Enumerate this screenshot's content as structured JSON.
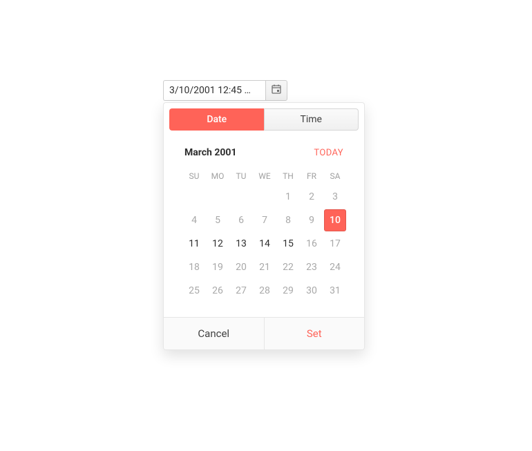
{
  "input": {
    "value": "3/10/2001 12:45 …"
  },
  "tabs": {
    "date": "Date",
    "time": "Time"
  },
  "calendar": {
    "month_label": "March 2001",
    "today_label": "TODAY",
    "weekdays": [
      "SU",
      "MO",
      "TU",
      "WE",
      "TH",
      "FR",
      "SA"
    ],
    "cells": [
      {
        "t": "",
        "cls": "empty"
      },
      {
        "t": "",
        "cls": "empty"
      },
      {
        "t": "",
        "cls": "empty"
      },
      {
        "t": "",
        "cls": "empty"
      },
      {
        "t": "1",
        "cls": "other"
      },
      {
        "t": "2",
        "cls": "other"
      },
      {
        "t": "3",
        "cls": "other"
      },
      {
        "t": "4",
        "cls": "other"
      },
      {
        "t": "5",
        "cls": "other"
      },
      {
        "t": "6",
        "cls": "other"
      },
      {
        "t": "7",
        "cls": "other"
      },
      {
        "t": "8",
        "cls": "other"
      },
      {
        "t": "9",
        "cls": "other"
      },
      {
        "t": "10",
        "cls": "selected"
      },
      {
        "t": "11",
        "cls": ""
      },
      {
        "t": "12",
        "cls": ""
      },
      {
        "t": "13",
        "cls": ""
      },
      {
        "t": "14",
        "cls": ""
      },
      {
        "t": "15",
        "cls": ""
      },
      {
        "t": "16",
        "cls": "other"
      },
      {
        "t": "17",
        "cls": "other"
      },
      {
        "t": "18",
        "cls": "other"
      },
      {
        "t": "19",
        "cls": "other"
      },
      {
        "t": "20",
        "cls": "other"
      },
      {
        "t": "21",
        "cls": "other"
      },
      {
        "t": "22",
        "cls": "other"
      },
      {
        "t": "23",
        "cls": "other"
      },
      {
        "t": "24",
        "cls": "other"
      },
      {
        "t": "25",
        "cls": "other"
      },
      {
        "t": "26",
        "cls": "other"
      },
      {
        "t": "27",
        "cls": "other"
      },
      {
        "t": "28",
        "cls": "other"
      },
      {
        "t": "29",
        "cls": "other"
      },
      {
        "t": "30",
        "cls": "other"
      },
      {
        "t": "31",
        "cls": "other"
      }
    ]
  },
  "footer": {
    "cancel": "Cancel",
    "set": "Set"
  }
}
